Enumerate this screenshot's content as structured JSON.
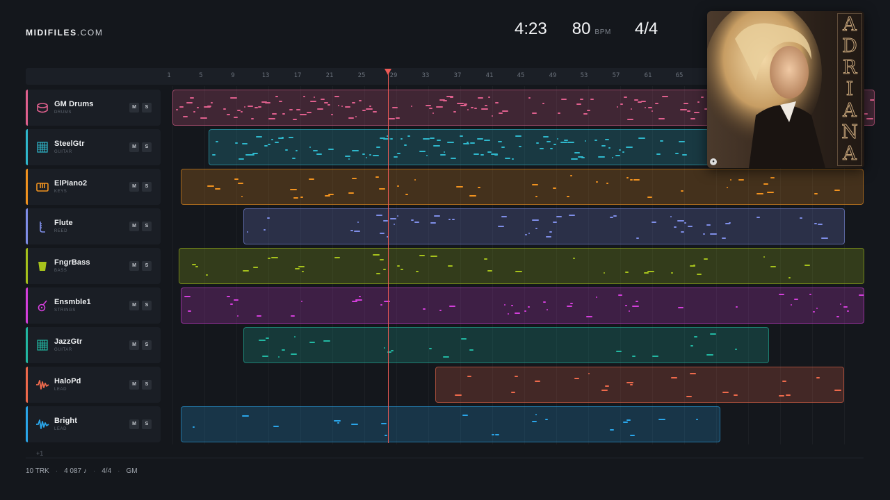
{
  "brand": {
    "name": "MIDIFILES",
    "domain": ".COM"
  },
  "stats": {
    "time": "4:23",
    "bpm": "80",
    "bpm_label": "BPM",
    "time_signature": "4/4"
  },
  "ruler_ticks": [
    "1",
    "5",
    "9",
    "13",
    "17",
    "21",
    "25",
    "29",
    "33",
    "37",
    "41",
    "45",
    "49",
    "53",
    "57",
    "61",
    "65"
  ],
  "tracks": [
    {
      "name": "GM Drums",
      "category": "DRUMS",
      "color": "#e0608e",
      "icon": "drum-icon",
      "mute": "M",
      "solo": "S"
    },
    {
      "name": "SteelGtr",
      "category": "GUITAR",
      "color": "#2fb8cc",
      "icon": "guitar-icon",
      "mute": "M",
      "solo": "S"
    },
    {
      "name": "ElPiano2",
      "category": "KEYS",
      "color": "#f2931f",
      "icon": "keys-icon",
      "mute": "M",
      "solo": "S"
    },
    {
      "name": "Flute",
      "category": "REED",
      "color": "#7f8ee8",
      "icon": "reed-icon",
      "mute": "M",
      "solo": "S"
    },
    {
      "name": "FngrBass",
      "category": "BASS",
      "color": "#a6c21c",
      "icon": "bass-icon",
      "mute": "M",
      "solo": "S"
    },
    {
      "name": "Ensmble1",
      "category": "STRINGS",
      "color": "#d43fdc",
      "icon": "strings-icon",
      "mute": "M",
      "solo": "S"
    },
    {
      "name": "JazzGtr",
      "category": "GUITAR",
      "color": "#22b8a2",
      "icon": "guitar-icon",
      "mute": "M",
      "solo": "S"
    },
    {
      "name": "HaloPd",
      "category": "LEAD",
      "color": "#ef6a4c",
      "icon": "waveform-icon",
      "mute": "M",
      "solo": "S"
    },
    {
      "name": "Bright",
      "category": "LEAD",
      "color": "#2aa6ea",
      "icon": "waveform-icon",
      "mute": "M",
      "solo": "S"
    }
  ],
  "more_tracks": "+1",
  "footer": {
    "tracks": "10 TRK",
    "notes": "4 087 ♪",
    "time_signature": "4/4",
    "standard": "GM"
  },
  "album": {
    "title": "ADRIANA",
    "letters": [
      "A",
      "D",
      "R",
      "I",
      "A",
      "N",
      "A"
    ]
  }
}
